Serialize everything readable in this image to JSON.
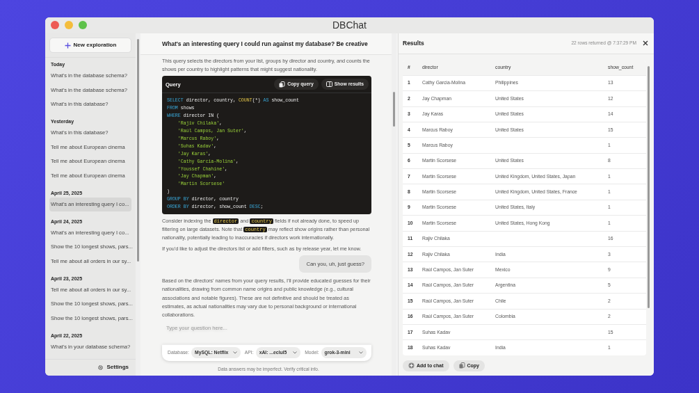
{
  "window": {
    "title": "DBChat"
  },
  "sidebar": {
    "new_button": "New exploration",
    "settings": "Settings",
    "groups": [
      {
        "label": "Today",
        "items": [
          {
            "title": "What's in the database schema?",
            "selected": false
          },
          {
            "title": "What's in the database schema?",
            "selected": false
          },
          {
            "title": "What's in this database?",
            "selected": false
          }
        ]
      },
      {
        "label": "Yesterday",
        "items": [
          {
            "title": "What's in this database?",
            "selected": false
          },
          {
            "title": "Tell me about European cinema",
            "selected": false
          },
          {
            "title": "Tell me about European cinema",
            "selected": false
          },
          {
            "title": "Tell me about European cinema",
            "selected": false
          }
        ]
      },
      {
        "label": "April 25, 2025",
        "items": [
          {
            "title": "What's an interesting query I co...",
            "selected": true
          }
        ]
      },
      {
        "label": "April 24, 2025",
        "items": [
          {
            "title": "What's an interesting query I co...",
            "selected": false
          },
          {
            "title": "Show the 10 longest shows, pars...",
            "selected": false
          },
          {
            "title": "Tell me about all orders in our sy...",
            "selected": false
          }
        ]
      },
      {
        "label": "April 23, 2025",
        "items": [
          {
            "title": "Tell me about all orders in our sy...",
            "selected": false
          },
          {
            "title": "Show the 10 longest shows, pars...",
            "selected": false
          },
          {
            "title": "Show the 10 longest shows, pars...",
            "selected": false
          }
        ]
      },
      {
        "label": "April 22, 2025",
        "items": [
          {
            "title": "What's in your database schema?",
            "selected": false
          }
        ]
      }
    ]
  },
  "chat": {
    "title": "What's an interesting query I could run against my database? Be creative",
    "blocks": [
      {
        "kind": "paragraph",
        "parts": [
          {
            "kind": "text",
            "text": "This query selects the directors from your list, groups by director and country, and counts the shows per country to highlight patterns that might suggest nationality."
          }
        ]
      },
      {
        "kind": "code",
        "title": "Query",
        "buttons": [
          "Copy query",
          "Show results"
        ],
        "lines": [
          [
            {
              "kind": "keyword",
              "text": "SELECT"
            },
            {
              "kind": "plain",
              "text": " director, country, "
            },
            {
              "kind": "function",
              "text": "COUNT"
            },
            {
              "kind": "plain",
              "text": "(*) "
            },
            {
              "kind": "keyword",
              "text": "AS"
            },
            {
              "kind": "plain",
              "text": " show_count"
            }
          ],
          [
            {
              "kind": "keyword",
              "text": "FROM"
            },
            {
              "kind": "plain",
              "text": " shows"
            }
          ],
          [
            {
              "kind": "keyword",
              "text": "WHERE"
            },
            {
              "kind": "plain",
              "text": " director IN ("
            }
          ],
          [
            {
              "kind": "string",
              "text": "    'Rajiv Chilaka'"
            },
            {
              "kind": "plain",
              "text": ","
            }
          ],
          [
            {
              "kind": "string",
              "text": "    'Raúl Campos, Jan Suter'"
            },
            {
              "kind": "plain",
              "text": ","
            }
          ],
          [
            {
              "kind": "string",
              "text": "    'Marcus Raboy'"
            },
            {
              "kind": "plain",
              "text": ","
            }
          ],
          [
            {
              "kind": "string",
              "text": "    'Suhas Kadav'"
            },
            {
              "kind": "plain",
              "text": ","
            }
          ],
          [
            {
              "kind": "string",
              "text": "    'Jay Karas'"
            },
            {
              "kind": "plain",
              "text": ","
            }
          ],
          [
            {
              "kind": "string",
              "text": "    'Cathy Garcia-Molina'"
            },
            {
              "kind": "plain",
              "text": ","
            }
          ],
          [
            {
              "kind": "string",
              "text": "    'Youssef Chahine'"
            },
            {
              "kind": "plain",
              "text": ","
            }
          ],
          [
            {
              "kind": "string",
              "text": "    'Jay Chapman'"
            },
            {
              "kind": "plain",
              "text": ","
            }
          ],
          [
            {
              "kind": "string",
              "text": "    'Martin Scorsese'"
            }
          ],
          [
            {
              "kind": "plain",
              "text": ")"
            }
          ],
          [
            {
              "kind": "keyword",
              "text": "GROUP BY"
            },
            {
              "kind": "plain",
              "text": " director, country"
            }
          ],
          [
            {
              "kind": "keyword",
              "text": "ORDER BY"
            },
            {
              "kind": "plain",
              "text": " director, show_count "
            },
            {
              "kind": "keyword",
              "text": "DESC"
            },
            {
              "kind": "plain",
              "text": ";"
            }
          ]
        ]
      },
      {
        "kind": "paragraph",
        "parts": [
          {
            "kind": "text",
            "text": "Consider indexing the "
          },
          {
            "kind": "code",
            "text": "director"
          },
          {
            "kind": "text",
            "text": " and "
          },
          {
            "kind": "code",
            "text": "country"
          },
          {
            "kind": "text",
            "text": " fields if not already done, to speed up filtering on large datasets. Note that "
          },
          {
            "kind": "code",
            "text": "country"
          },
          {
            "kind": "text",
            "text": " may reflect show origins rather than personal nationality, potentially leading to inaccuracies if directors work internationally."
          }
        ]
      },
      {
        "kind": "paragraph",
        "parts": [
          {
            "kind": "text",
            "text": "If you'd like to adjust the directors list or add filters, such as by release year, let me know."
          }
        ]
      },
      {
        "kind": "user",
        "text": "Can you, uh, just guess?"
      },
      {
        "kind": "paragraph",
        "parts": [
          {
            "kind": "text",
            "text": "Based on the directors' names from your query results, I'll provide educated guesses for their nationalities, drawing from common name origins and public knowledge (e.g., cultural associations and notable figures). These are not definitive and should be treated as estimates, as actual nationalities may vary due to personal background or international collaborations."
          }
        ]
      }
    ],
    "composer": {
      "placeholder": "Type your question here...",
      "selectors": [
        {
          "label": "Database:",
          "value": "MySQL: Netflix"
        },
        {
          "label": "API:",
          "value": "xAI: ...eclul5"
        },
        {
          "label": "Model:",
          "value": "grok-3-mini"
        }
      ]
    },
    "disclaimer": "Data answers may be imperfect. Verify critical info."
  },
  "results": {
    "title": "Results",
    "meta": "22 rows returned @ 7:37:29 PM",
    "columns": [
      "#",
      "director",
      "country",
      "show_count"
    ],
    "rows": [
      {
        "n": "1",
        "director": "Cathy Garcia-Molina",
        "country": "Philippines",
        "show_count": "13"
      },
      {
        "n": "2",
        "director": "Jay Chapman",
        "country": "United States",
        "show_count": "12"
      },
      {
        "n": "3",
        "director": "Jay Karas",
        "country": "United States",
        "show_count": "14"
      },
      {
        "n": "4",
        "director": "Marcus Raboy",
        "country": "United States",
        "show_count": "15"
      },
      {
        "n": "5",
        "director": "Marcus Raboy",
        "show_count": "1"
      },
      {
        "n": "6",
        "director": "Martin Scorsese",
        "country": "United States",
        "show_count": "8"
      },
      {
        "n": "7",
        "director": "Martin Scorsese",
        "country": "United Kingdom, United States, Japan",
        "show_count": "1"
      },
      {
        "n": "8",
        "director": "Martin Scorsese",
        "country": "United Kingdom, United States, France",
        "show_count": "1"
      },
      {
        "n": "9",
        "director": "Martin Scorsese",
        "country": "United States, Italy",
        "show_count": "1"
      },
      {
        "n": "10",
        "director": "Martin Scorsese",
        "country": "United States, Hong Kong",
        "show_count": "1"
      },
      {
        "n": "11",
        "director": "Rajiv Chilaka",
        "show_count": "16"
      },
      {
        "n": "12",
        "director": "Rajiv Chilaka",
        "country": "India",
        "show_count": "3"
      },
      {
        "n": "13",
        "director": "Raúl Campos, Jan Suter",
        "country": "Mexico",
        "show_count": "9"
      },
      {
        "n": "14",
        "director": "Raúl Campos, Jan Suter",
        "country": "Argentina",
        "show_count": "5"
      },
      {
        "n": "15",
        "director": "Raúl Campos, Jan Suter",
        "country": "Chile",
        "show_count": "2"
      },
      {
        "n": "16",
        "director": "Raúl Campos, Jan Suter",
        "country": "Colombia",
        "show_count": "2"
      },
      {
        "n": "17",
        "director": "Suhas Kadav",
        "show_count": "15"
      },
      {
        "n": "18",
        "director": "Suhas Kadav",
        "country": "India",
        "show_count": "1"
      }
    ],
    "buttons": [
      {
        "kind": "add",
        "label": "Add to chat"
      },
      {
        "kind": "copy",
        "label": "Copy"
      }
    ]
  }
}
